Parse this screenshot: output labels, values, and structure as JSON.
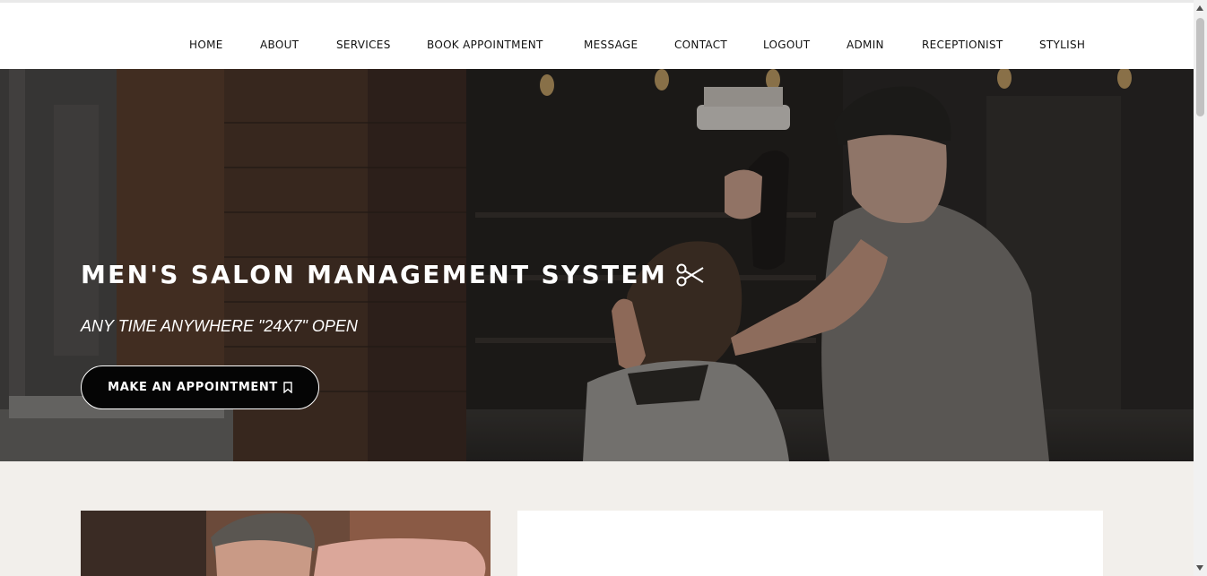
{
  "nav": {
    "items": [
      {
        "label": "HOME"
      },
      {
        "label": "ABOUT"
      },
      {
        "label": "SERVICES"
      },
      {
        "label": "BOOK APPOINTMENT"
      },
      {
        "label": "MESSAGE"
      },
      {
        "label": "CONTACT"
      },
      {
        "label": "LOGOUT"
      },
      {
        "label": "ADMIN"
      },
      {
        "label": "RECEPTIONIST"
      },
      {
        "label": "STYLISH"
      }
    ]
  },
  "hero": {
    "title": "MEN'S SALON MANAGEMENT SYSTEM",
    "title_icon": "scissors-icon",
    "subtitle": "ANY TIME ANYWHERE \"24X7\" OPEN",
    "cta_label": "MAKE AN APPOINTMENT",
    "cta_icon": "bookmark-icon"
  },
  "colors": {
    "nav_bg": "#ffffff",
    "page_bg": "#f2efeb",
    "cta_bg": "#050505",
    "text_light": "#ffffff"
  }
}
